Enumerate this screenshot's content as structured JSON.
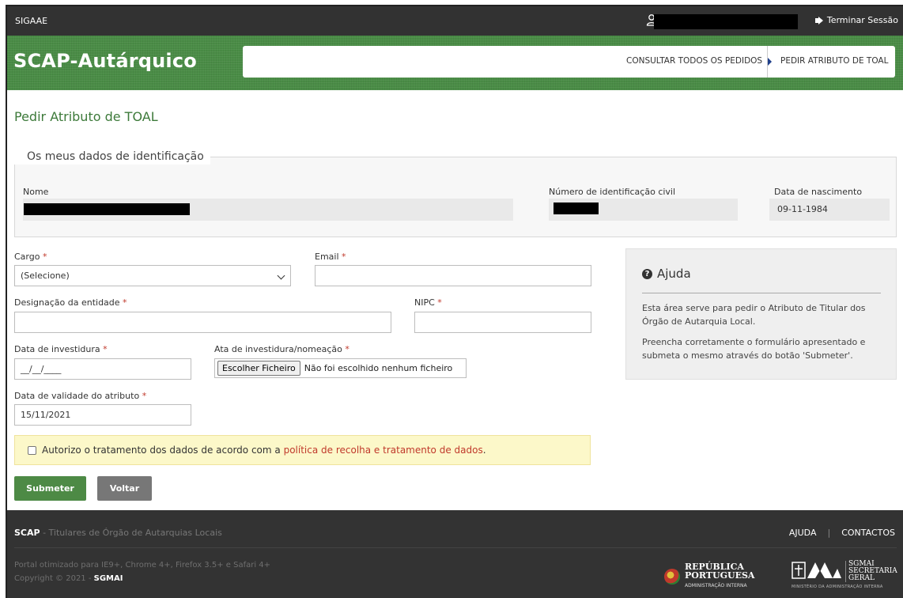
{
  "topbar": {
    "brand": "SIGAAE",
    "logout": "Terminar Sessão"
  },
  "header": {
    "title": "SCAP-Autárquico",
    "nav": {
      "consult": "CONSULTAR TODOS OS PEDIDOS",
      "request": "PEDIR ATRIBUTO DE TOAL"
    }
  },
  "page": {
    "title": "Pedir Atributo de TOAL"
  },
  "identity": {
    "legend": "Os meus dados de identificação",
    "name_label": "Nome",
    "civil_id_label": "Número de identificação civil",
    "birth_label": "Data de nascimento",
    "birth_value": "09-11-1984"
  },
  "form": {
    "cargo_label": "Cargo",
    "cargo_value": "(Selecione)",
    "email_label": "Email",
    "entity_label": "Designação da entidade",
    "nipc_label": "NIPC",
    "investiture_label": "Data de investidura",
    "investiture_placeholder": "__/__/____",
    "act_label": "Ata de investidura/nomeação",
    "file_button": "Escolher Ficheiro",
    "file_status": "Não foi escolhido nenhum ficheiro",
    "validity_label": "Data de validade do atributo",
    "validity_value": "15/11/2021",
    "required_mark": "*",
    "consent_text": "Autorizo o tratamento dos dados de acordo com a ",
    "consent_link": "política de recolha e tratamento de dados",
    "consent_end": ".",
    "submit": "Submeter",
    "back": "Voltar"
  },
  "help": {
    "title": "Ajuda",
    "p1": "Esta área serve para pedir o Atributo de Titular dos Órgão de Autarquia Local.",
    "p2": "Preencha corretamente o formulário apresentado e submeta o mesmo através do botão 'Submeter'."
  },
  "footer": {
    "scap": "SCAP",
    "scap_desc": " - Titulares de Órgão de Autarquias Locais",
    "help_link": "AJUDA",
    "sep": "|",
    "contacts_link": "CONTACTOS",
    "browsers": "Portal otimizado para IE9+, Chrome 4+, Firefox 3.5+ e Safari 4+",
    "copyright": "Copyright © 2021 - ",
    "copyright_org": "SGMAI",
    "logo_rep_l1": "REPÚBLICA",
    "logo_rep_l2": "PORTUGUESA",
    "logo_rep_l3": "ADMINISTRAÇÃO INTERNA",
    "logo_sgmai_l1": "SGMAI",
    "logo_sgmai_l2": "SECRETARIA",
    "logo_sgmai_l3": "GERAL",
    "logo_sgmai_sub": "MINISTÉRIO DA ADMINISTRAÇÃO INTERNA"
  },
  "colors": {
    "header_green": "#4a8c46",
    "title_green": "#3d7a3a",
    "required_red": "#c0392b",
    "nav_blue": "#1f3f8a",
    "topbar": "#323232",
    "footer": "#333333"
  },
  "icons": {
    "user": "user-icon",
    "logout": "logout-icon",
    "help": "question-circle-icon",
    "chevron": "chevron-down-icon"
  }
}
